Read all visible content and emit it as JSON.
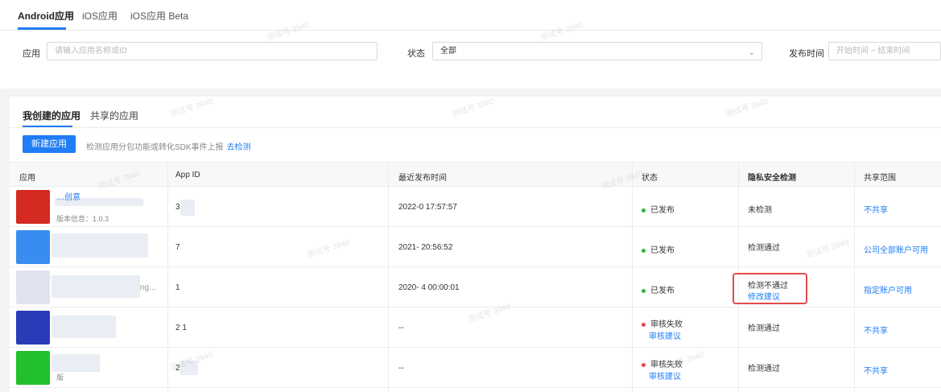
{
  "top_tabs": [
    "Android应用",
    "iOS应用",
    "iOS应用 Beta"
  ],
  "filters": {
    "app_label": "应用",
    "app_placeholder": "请输入应用名称或ID",
    "status_label": "状态",
    "status_value": "全部",
    "date_label": "发布时间",
    "date_placeholder": "开始时间 ~ 结束时间"
  },
  "sub_tabs": [
    "我创建的应用",
    "共享的应用"
  ],
  "new_button": "新建应用",
  "hint": {
    "text": "检测应用分包功能或转化SDK事件上报",
    "link": "去检测"
  },
  "columns": [
    "应用",
    "App ID",
    "最近发布时间",
    "状态",
    "隐私安全检测",
    "共享范围"
  ],
  "rows": [
    {
      "app_name": "…创意",
      "app_sub": "版本信息：1.0.3",
      "app_id": "3",
      "time": "2022-0        17:57:57",
      "status": "已发布",
      "status_color": "#2fb344",
      "status_link": "",
      "privacy": "未检测",
      "privacy_link": "",
      "share": "不共享"
    },
    {
      "app_name": "",
      "app_sub": "",
      "app_id": "      7",
      "time": "2021-         20:56:52",
      "status": "已发布",
      "status_color": "#2fb344",
      "status_link": "",
      "privacy": "检测通过",
      "privacy_link": "",
      "share": "公司全部账户可用"
    },
    {
      "app_name": "ng...",
      "app_sub": "",
      "app_id": "1",
      "time": "2020-         4 00:00:01",
      "status": "已发布",
      "status_color": "#2fb344",
      "status_link": "",
      "privacy": "检测不通过",
      "privacy_link": "修改建议",
      "share": "指定账户可用"
    },
    {
      "app_name": "",
      "app_sub": "",
      "app_id": "2        1",
      "time": "--",
      "status": "审核失败",
      "status_color": "#e54a4a",
      "status_link": "审核建议",
      "privacy": "检测通过",
      "privacy_link": "",
      "share": "不共享"
    },
    {
      "app_name": "",
      "app_sub": "版",
      "app_id": "2",
      "time": "--",
      "status": "审核失败",
      "status_color": "#e54a4a",
      "status_link": "审核建议",
      "privacy": "检测通过",
      "privacy_link": "",
      "share": "不共享"
    }
  ],
  "watermark": "测试号 3940"
}
